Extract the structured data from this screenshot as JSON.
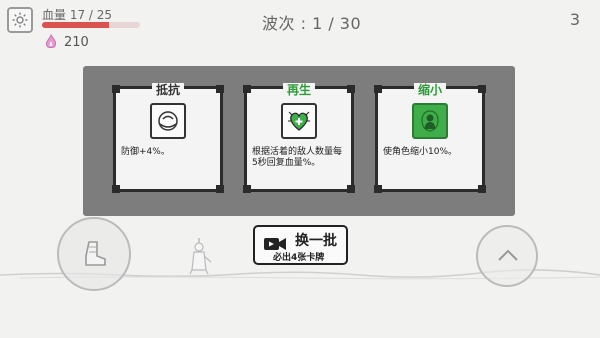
{
  "hud": {
    "hp_label": "血量",
    "hp_current": 17,
    "hp_max": 25,
    "hp_text": "17 / 25",
    "gems": "210",
    "wave_text": "波次 : 1 / 30",
    "corner_value": "3"
  },
  "cards": [
    {
      "title": "抵抗",
      "desc": "防御+4%。",
      "icon": "resist-face-icon"
    },
    {
      "title": "再生",
      "desc": "根据活着的敌人数量每5秒回复血量%。",
      "icon": "heart-regen-icon"
    },
    {
      "title": "缩小",
      "desc": "使角色缩小10%。",
      "icon": "shrink-silhouette-icon"
    }
  ],
  "refresh": {
    "label": "换一批",
    "sub_label": "必出4张卡牌"
  },
  "colors": {
    "hp_fill": "#d9534f",
    "panel": "#7d7d7d",
    "green_title": "#2e9b3a",
    "gem": "#e79bd0"
  }
}
